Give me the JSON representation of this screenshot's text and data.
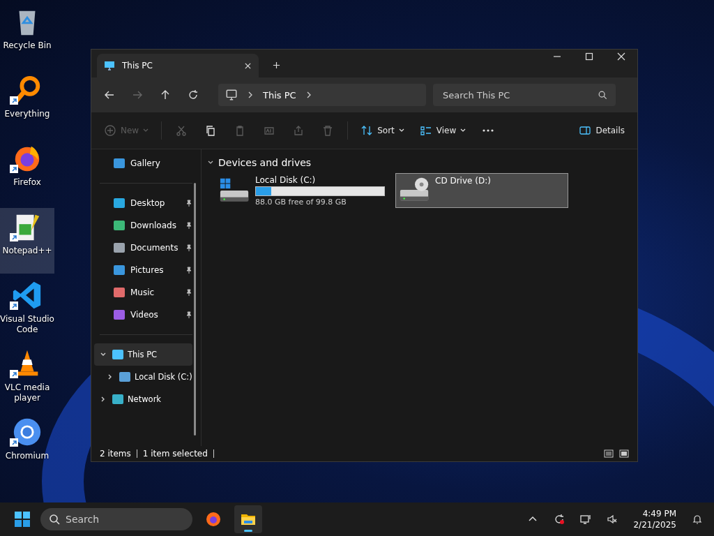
{
  "desktop_icons": [
    {
      "kind": "recycle",
      "label": "Recycle Bin",
      "shortcut": false,
      "selected": false
    },
    {
      "kind": "everything",
      "label": "Everything",
      "shortcut": true,
      "selected": false
    },
    {
      "kind": "firefox",
      "label": "Firefox",
      "shortcut": true,
      "selected": false
    },
    {
      "kind": "notepad",
      "label": "Notepad++",
      "shortcut": true,
      "selected": true
    },
    {
      "kind": "vscode",
      "label": "Visual Studio Code",
      "shortcut": true,
      "selected": false
    },
    {
      "kind": "vlc",
      "label": "VLC media player",
      "shortcut": true,
      "selected": false
    },
    {
      "kind": "chromium",
      "label": "Chromium",
      "shortcut": true,
      "selected": false
    }
  ],
  "window": {
    "tabs": [
      {
        "title": "This PC",
        "selected": true
      }
    ],
    "address": {
      "path": [
        "This PC"
      ]
    },
    "search": {
      "placeholder": "Search This PC"
    },
    "toolbar": [
      {
        "kind": "new",
        "label": "New",
        "disabled": true
      },
      {
        "kind": "cut",
        "disabled": true
      },
      {
        "kind": "copy",
        "disabled": false
      },
      {
        "kind": "paste",
        "disabled": true
      },
      {
        "kind": "rename",
        "disabled": true
      },
      {
        "kind": "share",
        "disabled": true
      },
      {
        "kind": "delete",
        "disabled": true
      },
      {
        "kind": "sort",
        "label": "Sort",
        "disabled": false
      },
      {
        "kind": "view",
        "label": "View",
        "disabled": false
      },
      {
        "kind": "more",
        "disabled": false
      }
    ],
    "details_label": "Details",
    "sidebar": {
      "top": [
        {
          "kind": "gallery",
          "label": "Gallery"
        }
      ],
      "quick_access": [
        {
          "kind": "desktop",
          "label": "Desktop",
          "pinned": true
        },
        {
          "kind": "downloads",
          "label": "Downloads",
          "pinned": true
        },
        {
          "kind": "documents",
          "label": "Documents",
          "pinned": true
        },
        {
          "kind": "pictures",
          "label": "Pictures",
          "pinned": true
        },
        {
          "kind": "music",
          "label": "Music",
          "pinned": true
        },
        {
          "kind": "videos",
          "label": "Videos",
          "pinned": true
        }
      ],
      "tree": [
        {
          "kind": "pc",
          "label": "This PC",
          "expanded": true,
          "selected": true,
          "children": [
            {
              "kind": "disk",
              "label": "Local Disk (C:)",
              "expanded": false,
              "selected": false
            }
          ]
        },
        {
          "kind": "network",
          "label": "Network",
          "expanded": false,
          "selected": false
        }
      ]
    },
    "group": {
      "title": "Devices and drives",
      "expanded": true
    },
    "drives": [
      {
        "kind": "disk",
        "name": "Local Disk (C:)",
        "level": 0.12,
        "free": "88.0 GB free of 99.8 GB",
        "selected": false
      },
      {
        "kind": "cd",
        "name": "CD Drive (D:)",
        "selected": true
      }
    ],
    "status": {
      "count": "2 items",
      "selection": "1 item selected"
    }
  },
  "taskbar": {
    "search_placeholder": "Search",
    "apps": [
      {
        "kind": "firefox",
        "active": false
      },
      {
        "kind": "explorer",
        "active": true
      }
    ],
    "time": "4:49 PM",
    "date": "2/21/2025"
  }
}
